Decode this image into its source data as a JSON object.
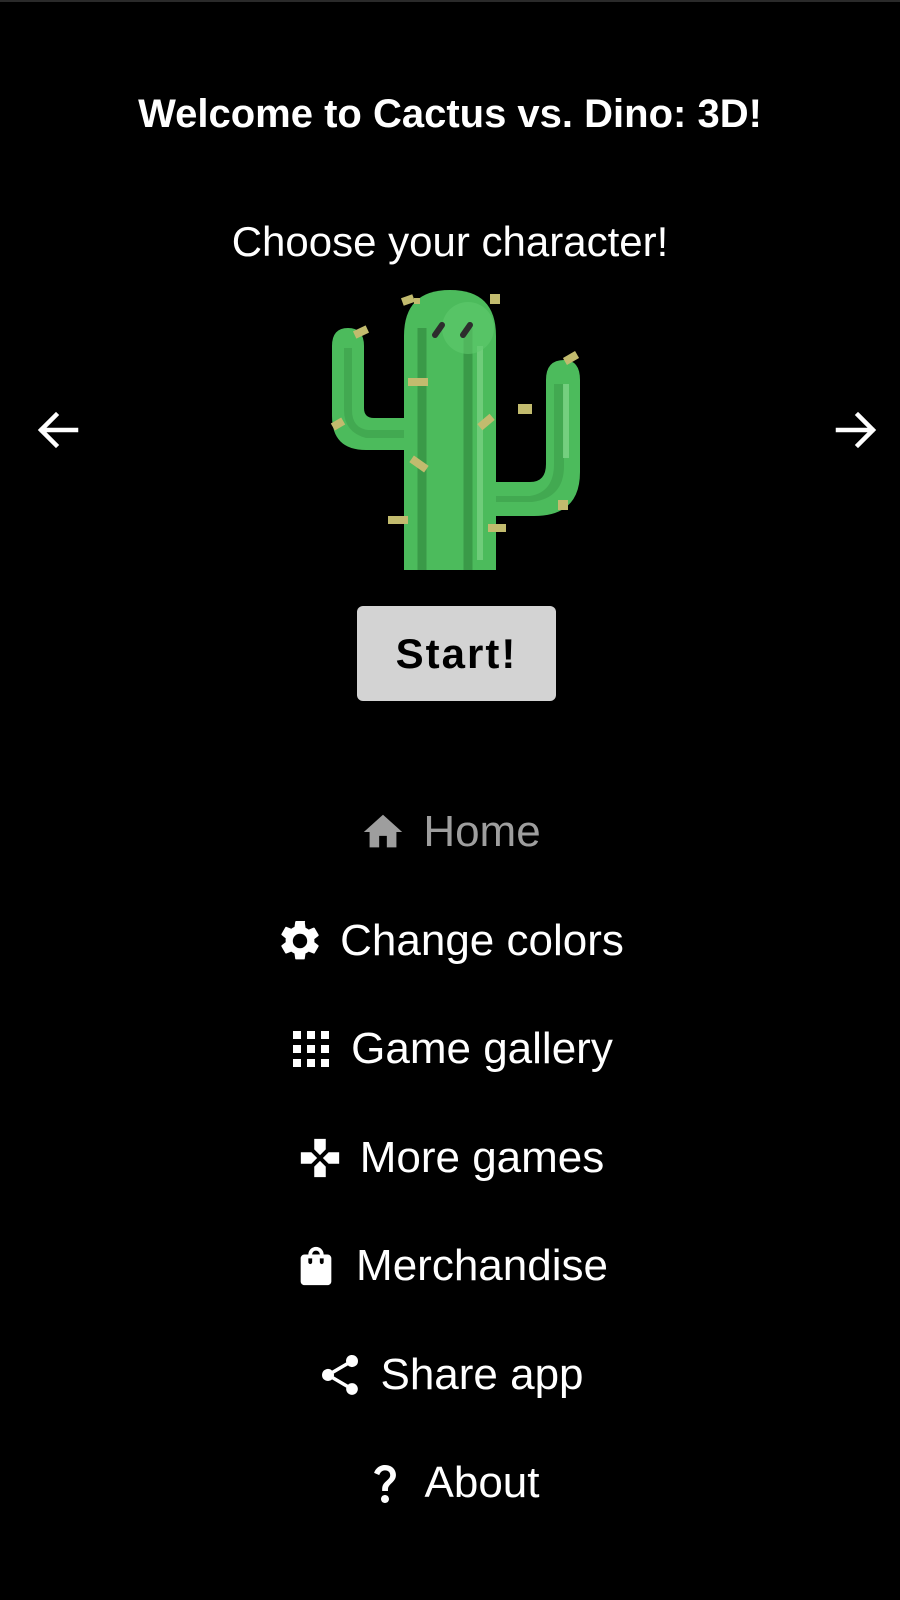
{
  "header": {
    "title": "Welcome to Cactus vs. Dino: 3D!",
    "subtitle": "Choose your character!"
  },
  "character_selector": {
    "current_character": "cactus",
    "prev_icon": "arrow-left-icon",
    "next_icon": "arrow-right-icon"
  },
  "start_button": {
    "label": "Start!"
  },
  "menu": {
    "items": [
      {
        "id": "home",
        "label": "Home",
        "icon": "home-icon",
        "active": true
      },
      {
        "id": "change-colors",
        "label": "Change colors",
        "icon": "gear-icon",
        "active": false
      },
      {
        "id": "game-gallery",
        "label": "Game gallery",
        "icon": "grid-icon",
        "active": false
      },
      {
        "id": "more-games",
        "label": "More games",
        "icon": "gamepad-icon",
        "active": false
      },
      {
        "id": "merchandise",
        "label": "Merchandise",
        "icon": "shopping-bag-icon",
        "active": false
      },
      {
        "id": "share-app",
        "label": "Share app",
        "icon": "share-icon",
        "active": false
      },
      {
        "id": "about",
        "label": "About",
        "icon": "question-icon",
        "active": false
      }
    ]
  },
  "colors": {
    "background": "#000000",
    "text": "#ffffff",
    "active_menu_text": "#9e9e9e",
    "start_button_bg": "#d3d3d3",
    "cactus_green": "#4cbb5c"
  }
}
